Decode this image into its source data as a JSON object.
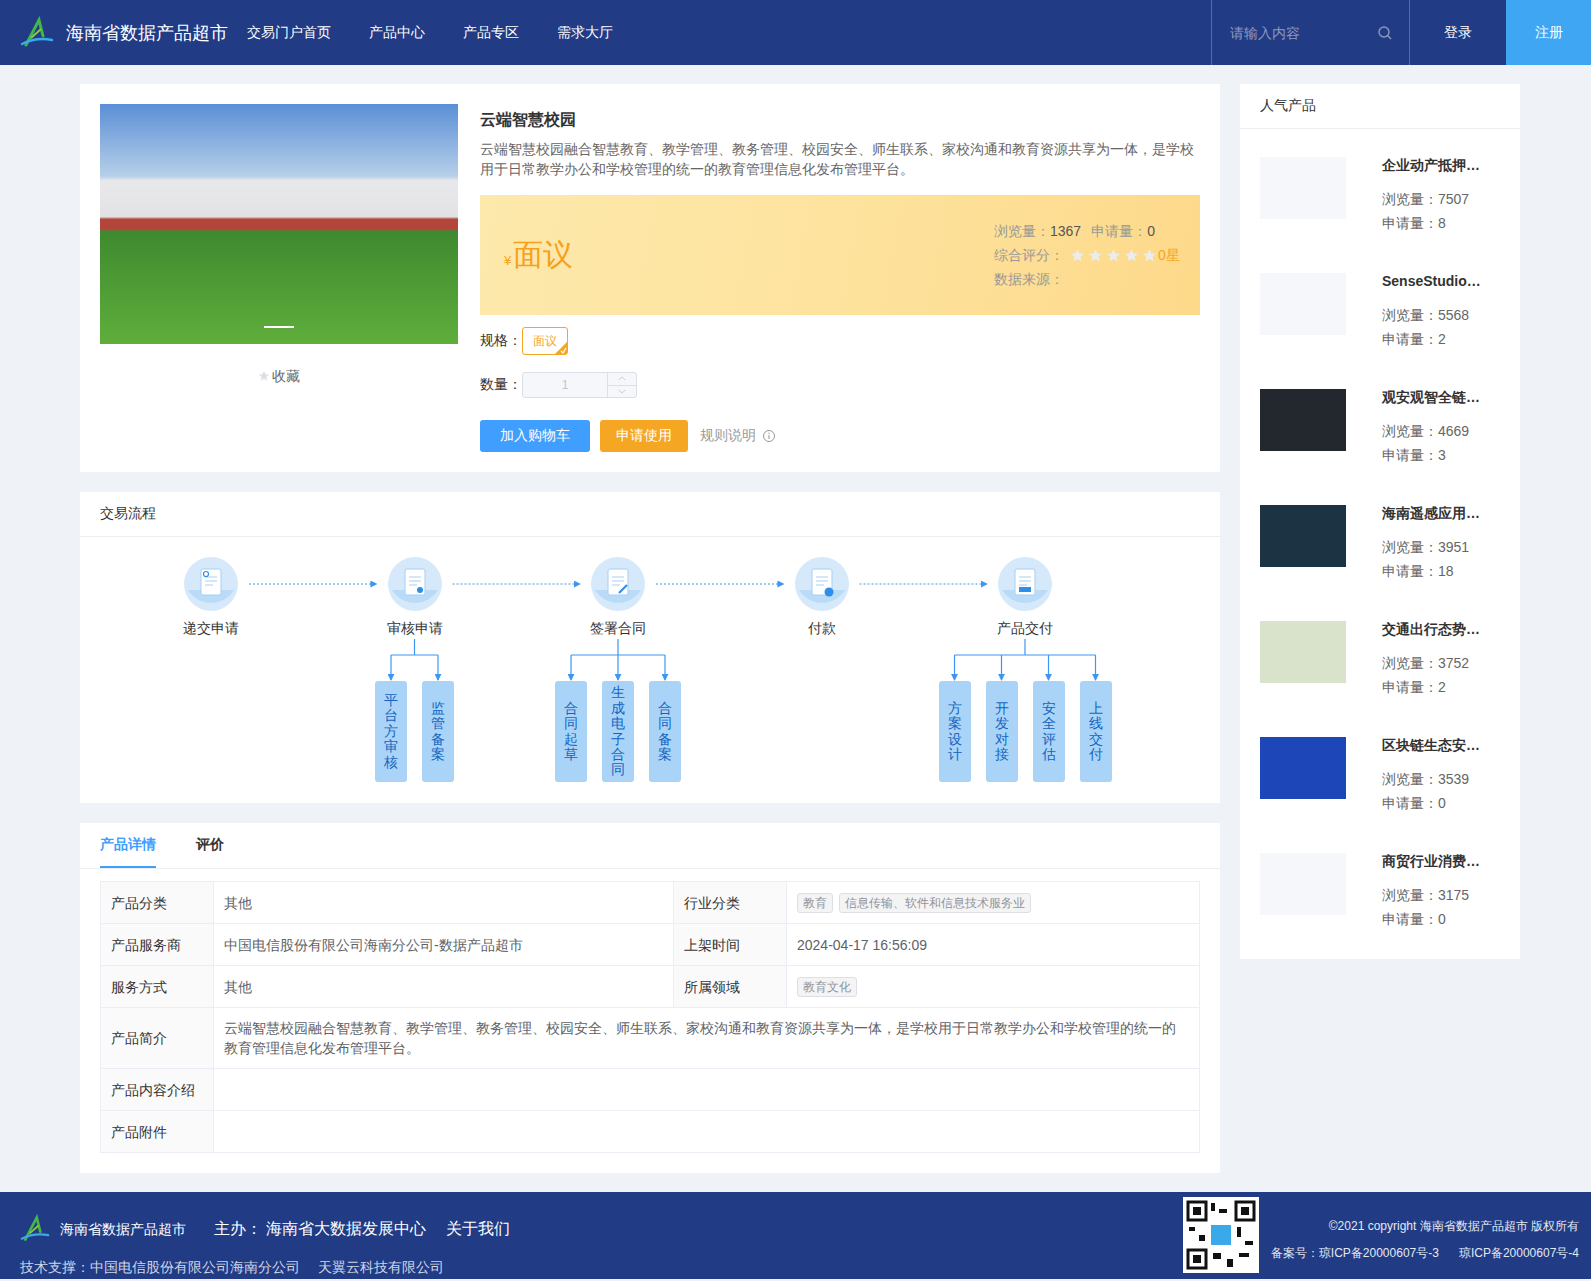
{
  "header": {
    "title": "海南省数据产品超市",
    "nav": [
      {
        "label": "交易门户首页",
        "selected": false
      },
      {
        "label": "产品中心",
        "selected": false
      },
      {
        "label": "产品专区",
        "selected": false
      },
      {
        "label": "需求大厅",
        "selected": false
      }
    ],
    "search": {
      "placeholder": "请输入内容"
    },
    "login": "登录",
    "register": "注册"
  },
  "product": {
    "title": "云端智慧校园",
    "description": "云端智慧校园融合智慧教育、教学管理、教务管理、校园安全、师生联系、家校沟通和教育资源共享为一体，是学校用于日常教学办公和学校管理的统一的教育管理信息化发布管理平台。",
    "carousel": [
      {
        "selected": true
      }
    ],
    "favorite": {
      "label": "收藏",
      "on": false
    },
    "price": {
      "currency": "¥",
      "value": "面议"
    },
    "stats": {
      "views_label": "浏览量：",
      "views": "1367",
      "applies_label": "申请量：",
      "applies": "0",
      "rating_label": "综合评分：",
      "stars": 0,
      "rating": "0星",
      "source_label": "数据来源：",
      "source": ""
    },
    "spec": {
      "label": "规格：",
      "options": [
        {
          "label": "面议",
          "selected": true
        }
      ]
    },
    "quantity": {
      "label": "数量：",
      "value": "1",
      "disabled": true
    },
    "buttons": {
      "cart": "加入购物车",
      "apply": "申请使用",
      "rules": "规则说明"
    }
  },
  "flow": {
    "title": "交易流程",
    "steps": [
      {
        "label": "递交申请",
        "branches": []
      },
      {
        "label": "审核申请",
        "branches": [
          "平台方审核",
          "监管备案"
        ]
      },
      {
        "label": "签署合同",
        "branches": [
          "合同起草",
          "生成电子合同",
          "合同备案"
        ]
      },
      {
        "label": "付款",
        "branches": []
      },
      {
        "label": "产品交付",
        "branches": [
          "方案设计",
          "开发对接",
          "安全评估",
          "上线交付"
        ]
      }
    ]
  },
  "details": {
    "tabs": [
      {
        "label": "产品详情",
        "selected": true
      },
      {
        "label": "评价",
        "selected": false
      }
    ],
    "rows": [
      [
        {
          "label": "产品分类",
          "kind": "text",
          "value": "其他",
          "tags": []
        },
        {
          "label": "行业分类",
          "kind": "tags",
          "value": "",
          "tags": [
            "教育",
            "信息传输、软件和信息技术服务业"
          ]
        }
      ],
      [
        {
          "label": "产品服务商",
          "kind": "text",
          "value": "中国电信股份有限公司海南分公司-数据产品超市",
          "tags": []
        },
        {
          "label": "上架时间",
          "kind": "text",
          "value": "2024-04-17 16:56:09",
          "tags": []
        }
      ],
      [
        {
          "label": "服务方式",
          "kind": "text",
          "value": "其他",
          "tags": []
        },
        {
          "label": "所属领域",
          "kind": "tags",
          "value": "",
          "tags": [
            "教育文化"
          ]
        }
      ],
      [
        {
          "label": "产品简介",
          "kind": "text",
          "value": "云端智慧校园融合智慧教育、教学管理、教务管理、校园安全、师生联系、家校沟通和教育资源共享为一体，是学校用于日常教学办公和学校管理的统一的教育管理信息化发布管理平台。",
          "tags": []
        }
      ],
      [
        {
          "label": "产品内容介绍",
          "kind": "text",
          "value": "",
          "tags": []
        }
      ],
      [
        {
          "label": "产品附件",
          "kind": "text",
          "value": "",
          "tags": []
        }
      ]
    ]
  },
  "popular": {
    "title": "人气产品",
    "views_label": "浏览量：",
    "applies_label": "申请量：",
    "items": [
      {
        "title": "企业动产抵押…",
        "views": "7507",
        "applies": "8",
        "color": "#f5f7fa"
      },
      {
        "title": "SenseStudio…",
        "views": "5568",
        "applies": "2",
        "color": "#f5f7fa"
      },
      {
        "title": "观安观智全链…",
        "views": "4669",
        "applies": "3",
        "color": "#23272e"
      },
      {
        "title": "海南遥感应用…",
        "views": "3951",
        "applies": "18",
        "color": "#1c3343"
      },
      {
        "title": "交通出行态势…",
        "views": "3752",
        "applies": "2",
        "color": "#d9e3cc"
      },
      {
        "title": "区块链生态安…",
        "views": "3539",
        "applies": "0",
        "color": "#1d47b8"
      },
      {
        "title": "商贸行业消费…",
        "views": "3175",
        "applies": "0",
        "color": "#f5f7fa"
      }
    ]
  },
  "footer": {
    "title": "海南省数据产品超市",
    "host_label": "主办：",
    "host": "海南省大数据发展中心",
    "about": "关于我们",
    "support": "技术支撑：中国电信股份有限公司海南分公司",
    "support2": "天翼云科技有限公司",
    "copyright": "©2021 copyright 海南省数据产品超市 版权所有",
    "records": [
      "备案号：琼ICP备20000607号-3",
      "琼ICP备20000607号-4"
    ]
  }
}
